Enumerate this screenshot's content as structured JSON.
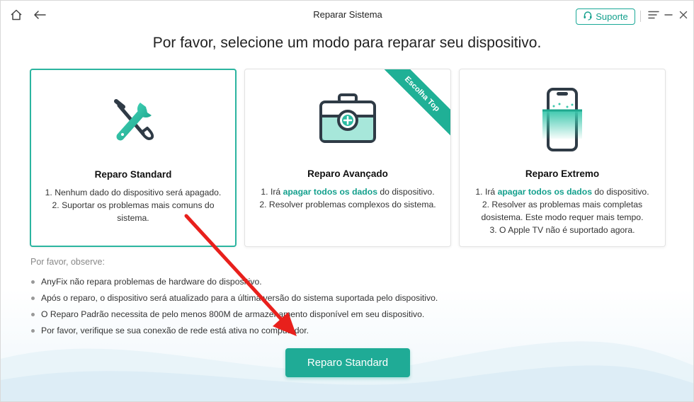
{
  "window": {
    "title": "Reparar Sistema"
  },
  "toolbar": {
    "support_label": "Suporte"
  },
  "heading": "Por favor, selecione um modo para reparar seu dispositivo.",
  "cards": [
    {
      "title": "Reparo Standard",
      "lines": [
        "1. Nenhum dado do dispositivo será apagado.",
        "2. Suportar os problemas mais comuns do sistema."
      ]
    },
    {
      "title": "Reparo Avançado",
      "badge": "Escolha Top",
      "line1_pre": "1. Irá ",
      "line1_hl": "apagar todos os dados",
      "line1_post": " do dispositivo.",
      "line2": "2. Resolver problemas complexos do sistema."
    },
    {
      "title": "Reparo Extremo",
      "line1_pre": "1. Irá ",
      "line1_hl": "apagar todos os dados",
      "line1_post": " do dispositivo.",
      "line2": "2. Resolver as problemas mais completas dosistema. Este modo requer mais tempo.",
      "line3": "3. O Apple TV não é suportado agora."
    }
  ],
  "notes": {
    "title": "Por favor, observe:",
    "items": [
      "AnyFix não repara problemas de hardware do dispositivo.",
      "Após o reparo, o dispositivo será atualizado para a última versão do sistema suportada pelo dispositivo.",
      "O Reparo Padrão necessita de pelo menos 800M de armazenamento disponível em seu dispositivo.",
      "Por favor, verifique se sua conexão de rede está ativa no computador."
    ]
  },
  "primary_button": {
    "label": "Reparo Standard"
  },
  "colors": {
    "accent": "#1fab96",
    "arrow": "#e8201c"
  },
  "icons": [
    "home-icon",
    "back-icon",
    "headset-icon",
    "menu-icon",
    "minimize-icon",
    "close-icon",
    "tools-icon",
    "medical-kit-icon",
    "phone-scan-icon"
  ]
}
